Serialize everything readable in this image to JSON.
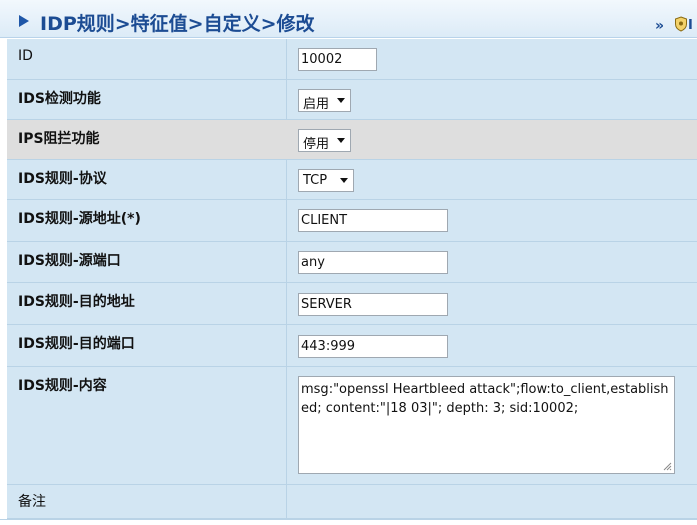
{
  "header": {
    "title": "IDP规则>特征值>自定义>修改",
    "more_symbol": "»",
    "cut_text": "I",
    "icon": "shield-lock-icon"
  },
  "form": {
    "id_label": "ID",
    "id_value": "10002",
    "ids_detect_label": "IDS检测功能",
    "ids_detect_value": "启用",
    "ips_block_label": "IPS阻拦功能",
    "ips_block_value": "停用",
    "protocol_label": "IDS规则-协议",
    "protocol_value": "TCP",
    "src_addr_label": "IDS规则-源地址(*)",
    "src_addr_value": "CLIENT",
    "src_port_label": "IDS规则-源端口",
    "src_port_value": "any",
    "dst_addr_label": "IDS规则-目的地址",
    "dst_addr_value": "SERVER",
    "dst_port_label": "IDS规则-目的端口",
    "dst_port_value": "443:999",
    "content_label": "IDS规则-内容",
    "content_value": "msg:\"openssl Heartbleed attack\";flow:to_client,established; content:\"|18 03|\"; depth: 3; sid:10002;",
    "note_label": "备注",
    "note_value": ""
  },
  "colors": {
    "row_bg": "#d3e6f3",
    "alt_row_bg": "#dedede",
    "title_color": "#1c4c93"
  }
}
